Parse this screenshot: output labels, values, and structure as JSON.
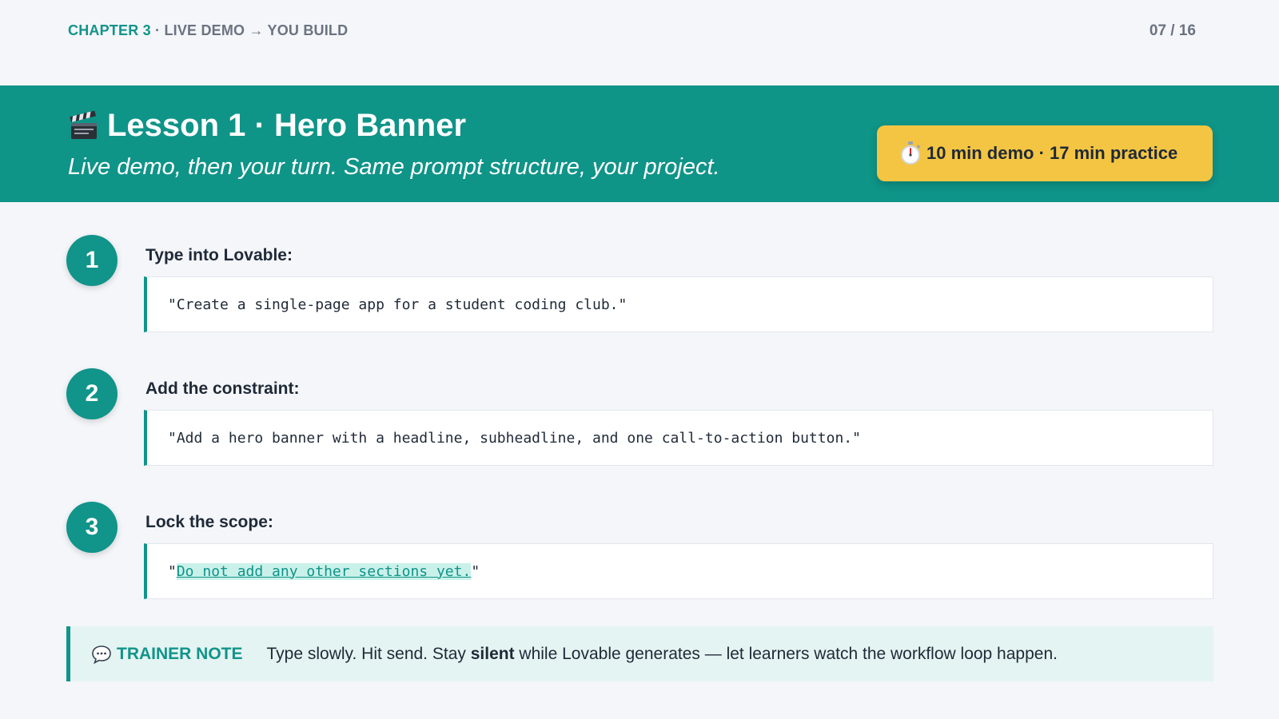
{
  "header": {
    "chapter": "CHAPTER 3",
    "separator": " · ",
    "chapter_subtitle": "LIVE DEMO → YOU BUILD",
    "page_number": "07 / 16"
  },
  "hero": {
    "icon": "clapper-board-icon",
    "title": "Lesson 1 · Hero Banner",
    "subtitle": "Live demo, then your turn. Same prompt structure, your project.",
    "time_badge": {
      "icon": "stopwatch-icon",
      "label": "10 min demo · 17 min practice"
    }
  },
  "steps": [
    {
      "number": "1",
      "label": "Type into Lovable:",
      "prompt": "\"Create a single-page app for a student coding club.\""
    },
    {
      "number": "2",
      "label": "Add the constraint:",
      "prompt": "\"Add a hero banner with a headline, subheadline, and one call-to-action button.\""
    },
    {
      "number": "3",
      "label": "Lock the scope:",
      "prompt_open_quote": "\"",
      "prompt_highlight": "Do not add any other sections yet.",
      "prompt_close_quote": "\""
    }
  ],
  "trainer_note": {
    "icon": "speech-bubble-icon",
    "label": "TRAINER NOTE",
    "text_before": "Type slowly. Hit send. Stay ",
    "text_bold": "silent",
    "text_after": " while Lovable generates — let learners watch the workflow loop happen."
  },
  "colors": {
    "accent": "#0f9488",
    "badge": "#f4c542",
    "background": "#f4f6fa",
    "note_background": "#e4f4f2"
  }
}
